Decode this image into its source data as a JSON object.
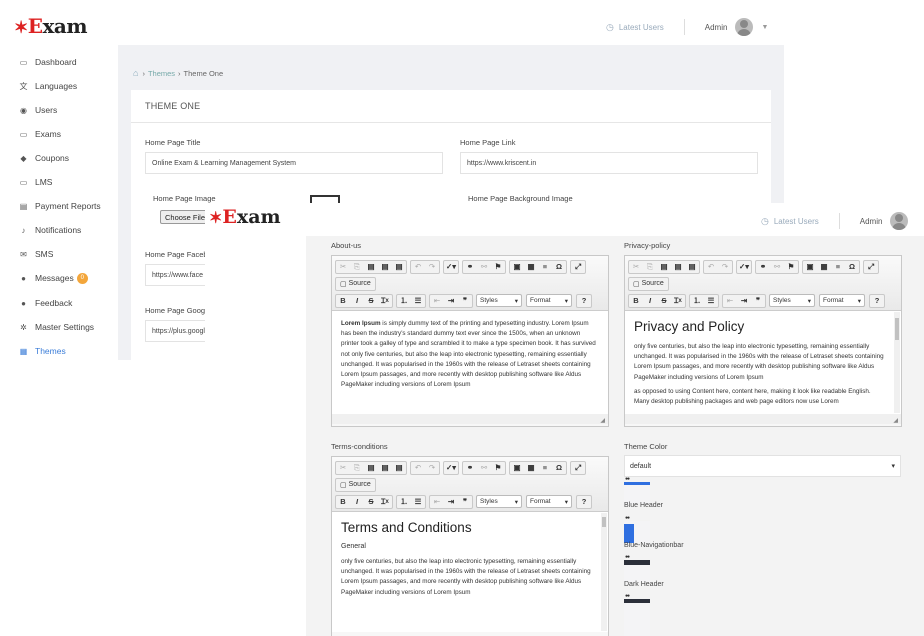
{
  "app": {
    "logo": "Exam",
    "latest_users": "Latest Users",
    "admin": "Admin"
  },
  "sidebar": {
    "items": [
      {
        "label": "Dashboard",
        "icon": "monitor-icon"
      },
      {
        "label": "Languages",
        "icon": "translate-icon"
      },
      {
        "label": "Users",
        "icon": "user-icon"
      },
      {
        "label": "Exams",
        "icon": "desktop-icon"
      },
      {
        "label": "Coupons",
        "icon": "tag-icon"
      },
      {
        "label": "LMS",
        "icon": "screen-icon"
      },
      {
        "label": "Payment Reports",
        "icon": "card-icon"
      },
      {
        "label": "Notifications",
        "icon": "bell-icon"
      },
      {
        "label": "SMS",
        "icon": "mail-icon"
      },
      {
        "label": "Messages",
        "icon": "chat-icon",
        "badge": "0"
      },
      {
        "label": "Feedback",
        "icon": "comment-icon"
      },
      {
        "label": "Master Settings",
        "icon": "gear-icon"
      },
      {
        "label": "Themes",
        "icon": "grid-icon",
        "active": true
      }
    ]
  },
  "breadcrumb": {
    "themes": "Themes",
    "current": "Theme One"
  },
  "card": {
    "title": "THEME ONE"
  },
  "form": {
    "home_page_title_label": "Home Page Title",
    "home_page_title_value": "Online Exam & Learning Management System",
    "home_page_link_label": "Home Page Link",
    "home_page_link_value": "https://www.kriscent.in",
    "home_page_image_label": "Home Page Image",
    "choose_file": "Choose File",
    "home_page_bg_label": "Home Page Background Image",
    "home_page_facebook_label": "Home Page Facebo",
    "home_page_facebook_value": "https://www.face",
    "home_page_google_label": "Home Page Googl",
    "home_page_google_value": "https://plus.googl"
  },
  "editors": {
    "source": "Source",
    "styles": "Styles",
    "format": "Format",
    "about_label": "About-us",
    "about_bold": "Lorem Ipsum",
    "about_text": " is simply dummy text of the printing and typesetting industry. Lorem Ipsum has been the industry's standard dummy text ever since the 1500s, when an unknown printer took a galley of type and scrambled it to make a type specimen book. It has survived not only five centuries, but also the leap into electronic typesetting, remaining essentially unchanged. It was popularised in the 1960s with the release of Letraset sheets containing Lorem Ipsum passages, and more recently with desktop publishing software like Aldus PageMaker including versions of Lorem Ipsum",
    "privacy_label": "Privacy-policy",
    "privacy_heading": "Privacy and Policy",
    "privacy_p1": "only five centuries, but also the leap into electronic typesetting, remaining essentially unchanged. It was popularised in the 1960s with the release of Letraset sheets containing Lorem Ipsum passages, and more recently with desktop publishing software like Aldus PageMaker including versions of Lorem Ipsum",
    "privacy_p2": "as opposed to using Content here, content here, making it look like readable English. Many desktop publishing packages and web page editors now use Lorem",
    "terms_label": "Terms-conditions",
    "terms_heading": "Terms and Conditions",
    "terms_sub": "General",
    "terms_p1": "only five centuries, but also the leap into electronic typesetting, remaining essentially unchanged. It was popularised in the 1960s with the release of Letraset sheets containing Lorem Ipsum passages, and more recently with desktop publishing software like Aldus PageMaker including versions of Lorem Ipsum"
  },
  "theme_color": {
    "label": "Theme Color",
    "selected": "default",
    "options": [
      {
        "label": "Blue Header",
        "color": "#2f6fe0"
      },
      {
        "label": "Blue-Navigationbar",
        "color": "#2f6fe0"
      },
      {
        "label": "Dark Header",
        "color": "#2b2f3a"
      }
    ]
  }
}
